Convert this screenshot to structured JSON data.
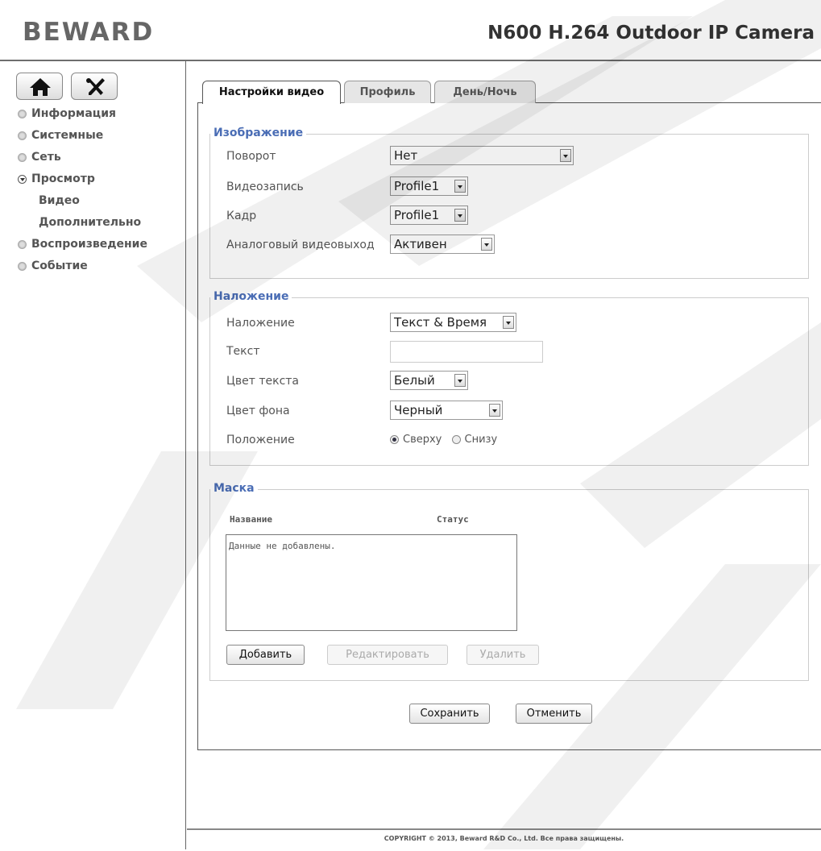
{
  "header": {
    "logo": "BEWARD",
    "title": "N600 H.264 Outdoor IP Camera"
  },
  "sidebar": {
    "items": [
      {
        "label": "Информация"
      },
      {
        "label": "Системные"
      },
      {
        "label": "Сеть"
      },
      {
        "label": "Просмотр"
      },
      {
        "label": "Видео"
      },
      {
        "label": "Дополнительно"
      },
      {
        "label": "Воспроизведение"
      },
      {
        "label": "Событие"
      }
    ]
  },
  "tabs": [
    {
      "label": "Настройки видео"
    },
    {
      "label": "Профиль"
    },
    {
      "label": "День/Ночь"
    }
  ],
  "image_section": {
    "title": "Изображение",
    "rotation_label": "Поворот",
    "rotation_value": "Нет",
    "record_label": "Видеозапись",
    "record_value": "Profile1",
    "frame_label": "Кадр",
    "frame_value": "Profile1",
    "analog_label": "Аналоговый видеовыход",
    "analog_value": "Активен"
  },
  "overlay_section": {
    "title": "Наложение",
    "overlay_label": "Наложение",
    "overlay_value": "Текст & Время",
    "text_label": "Текст",
    "text_value": "",
    "text_color_label": "Цвет текста",
    "text_color_value": "Белый",
    "bg_color_label": "Цвет фона",
    "bg_color_value": "Черный",
    "position_label": "Положение",
    "position_top": "Сверху",
    "position_bottom": "Снизу"
  },
  "mask_section": {
    "title": "Маска",
    "col_name": "Название",
    "col_status": "Статус",
    "empty_text": "Данные не добавлены.",
    "add_label": "Добавить",
    "edit_label": "Редактировать",
    "delete_label": "Удалить"
  },
  "actions": {
    "save_label": "Сохранить",
    "cancel_label": "Отменить"
  },
  "footer": {
    "copyright": "COPYRIGHT © 2013, Beward R&D Co., Ltd. Все права защищены."
  }
}
